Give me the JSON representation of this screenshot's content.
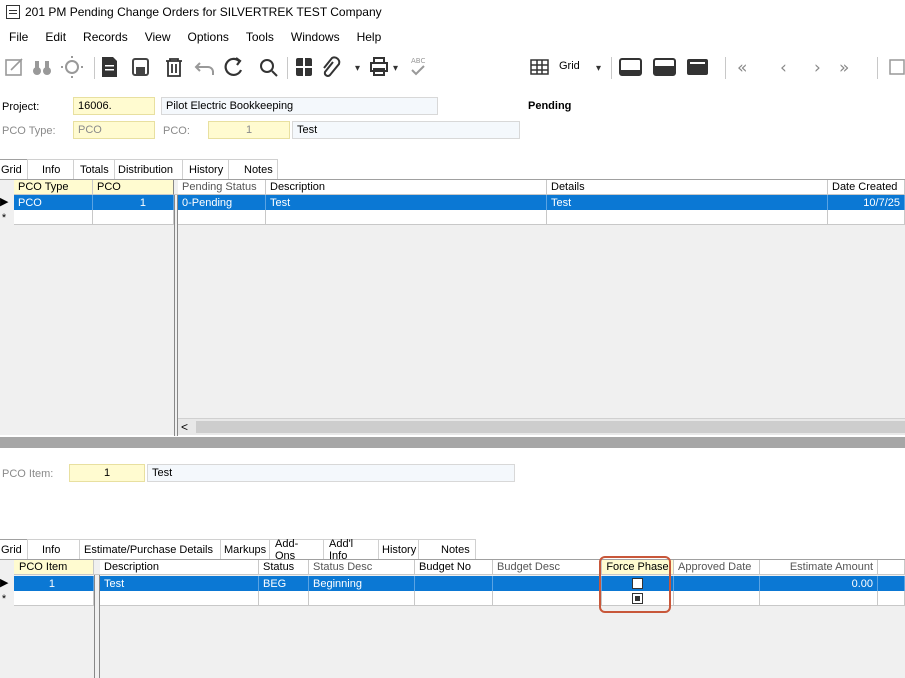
{
  "window": {
    "title": "201 PM Pending Change Orders for SILVERTREK TEST Company"
  },
  "menu": [
    "File",
    "Edit",
    "Records",
    "View",
    "Options",
    "Tools",
    "Windows",
    "Help"
  ],
  "toolbar": {
    "grid_label": "Grid"
  },
  "header": {
    "project_label": "Project:",
    "project_value": "16006.",
    "project_desc": "Pilot Electric Bookkeeping",
    "status": "Pending",
    "pco_type_label": "PCO Type:",
    "pco_type_value": "PCO",
    "pco_label": "PCO:",
    "pco_value": "1",
    "pco_desc": "Test"
  },
  "top_tabs": [
    "Grid",
    "Info",
    "Totals",
    "Distribution",
    "History",
    "Notes"
  ],
  "top_grid": {
    "columns": [
      "PCO Type",
      "PCO",
      "Pending Status",
      "Description",
      "Details",
      "Date Created"
    ],
    "rows": [
      {
        "pco_type": "PCO",
        "pco": "1",
        "pending_status": "0-Pending",
        "description": "Test",
        "details": "Test",
        "date_created": "10/7/25"
      }
    ]
  },
  "item": {
    "label": "PCO Item:",
    "value": "1",
    "desc": "Test"
  },
  "bottom_tabs": [
    "Grid",
    "Info",
    "Estimate/Purchase Details",
    "Markups",
    "Add-Ons",
    "Add'l Info",
    "History",
    "Notes"
  ],
  "bottom_grid": {
    "columns": [
      "PCO Item",
      "Description",
      "Status",
      "Status Desc",
      "Budget No",
      "Budget Desc",
      "Force Phase",
      "Approved Date",
      "Estimate Amount"
    ],
    "rows": [
      {
        "pco_item": "1",
        "description": "Test",
        "status": "BEG",
        "status_desc": "Beginning",
        "budget_no": "",
        "budget_desc": "",
        "force_phase": false,
        "approved_date": "",
        "estimate_amount": "0.00"
      }
    ],
    "new_row_force_phase": true
  },
  "colors": {
    "selection": "#0b78d4",
    "highlight": "#c8573a",
    "key_field": "#fffbd0"
  }
}
